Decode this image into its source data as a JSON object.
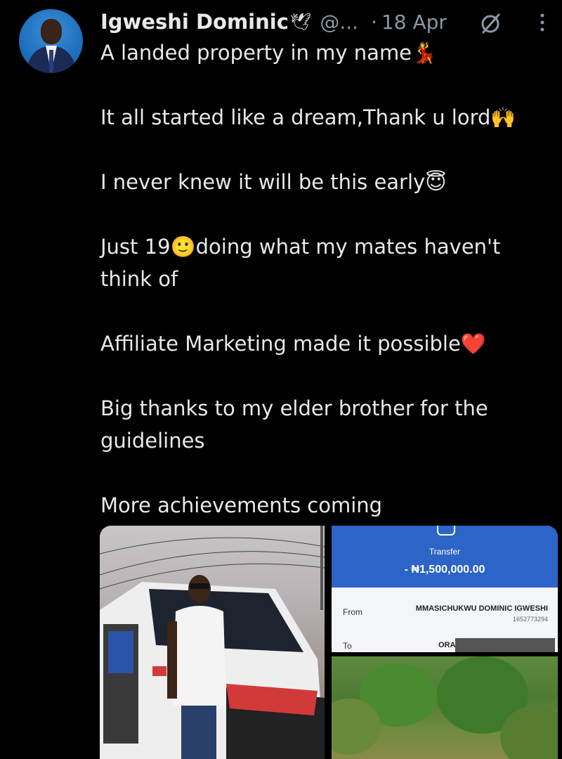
{
  "tweet": {
    "author_name": "Igweshi Dominic",
    "author_emoji": "🕊",
    "handle": "@...",
    "separator": "·",
    "date": "18 Apr",
    "paragraphs": [
      [
        "A landed property in my name💃"
      ],
      [
        "It all started like a dream,Thank u lord🙌"
      ],
      [
        "I never knew it will be this early😇"
      ],
      [
        "Just 19🙂doing what my mates haven't",
        "think of"
      ],
      [
        "Affiliate Marketing made it possible❤️"
      ],
      [
        "Big thanks to my elder brother for the",
        "guidelines"
      ],
      [
        "More achievements coming"
      ]
    ]
  },
  "receipt": {
    "transfer_label": "Transfer",
    "amount": "- ₦1,500,000.00",
    "from_label": "From",
    "from_name": "MMASICHUKWU DOMINIC IGWESHI",
    "from_account": "1652773294",
    "to_label": "To",
    "to_name": "ORA"
  },
  "icons": {
    "grok": "grok-icon",
    "more": "more-vertical-icon",
    "bank": "bank-icon"
  },
  "colors": {
    "background": "#000000",
    "text": "#e7e9ea",
    "muted": "#8b98a5",
    "bank_blue": "#2c64c7"
  }
}
